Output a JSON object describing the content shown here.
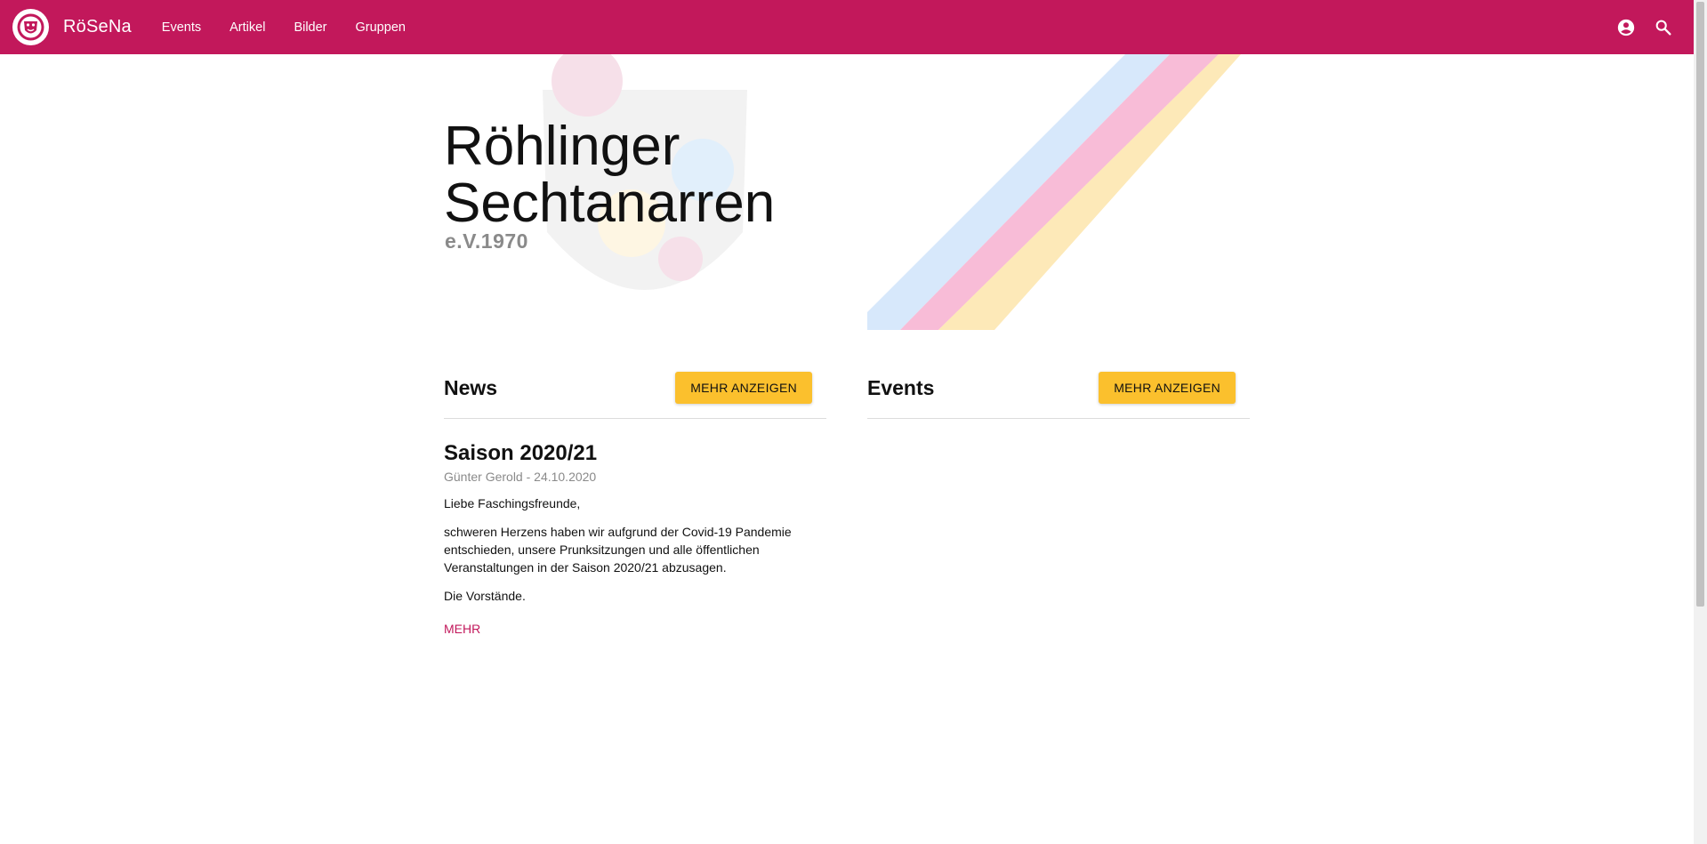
{
  "appbar": {
    "brand": "RöSeNa",
    "nav": [
      "Events",
      "Artikel",
      "Bilder",
      "Gruppen"
    ],
    "icons": [
      "account-circle-icon",
      "search-icon"
    ],
    "color": "#c2185b"
  },
  "hero": {
    "title_line1": "Röhlinger",
    "title_line2": "Sechtanarren",
    "subtitle": "e.V.1970",
    "stripe_colors": [
      "#d7e8fb",
      "#f8bcd7",
      "#fde9b8"
    ]
  },
  "news": {
    "heading": "News",
    "more_button": "MEHR ANZEIGEN",
    "article": {
      "title": "Saison 2020/21",
      "meta": "Günter Gerold - 24.10.2020",
      "paragraphs": [
        "Liebe Faschingsfreunde,",
        "schweren Herzens haben wir aufgrund der Covid-19 Pandemie entschieden, unsere Prunksitzungen und alle öffentlichen Veranstaltungen in der Saison 2020/21 abzusagen.",
        "Die Vorstände."
      ],
      "more_link": "MEHR"
    }
  },
  "events": {
    "heading": "Events",
    "more_button": "MEHR ANZEIGEN"
  },
  "colors": {
    "accent": "#c2185b",
    "button": "#fbc02d"
  }
}
